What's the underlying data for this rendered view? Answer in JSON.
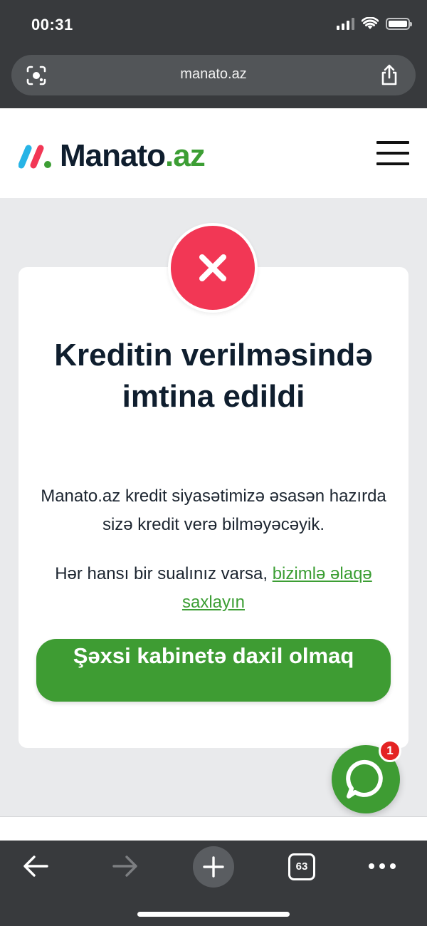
{
  "status_bar": {
    "time": "00:31"
  },
  "browser": {
    "url": "manato.az",
    "tab_count": "63"
  },
  "site": {
    "logo_name": "Manato",
    "logo_tld": ".az"
  },
  "card": {
    "title": "Kreditin verilməsində imtina edildi",
    "message": "Manato.az kredit siyasətimizə əsasən hazırda sizə kredit verə bilməyəcəyik.",
    "contact_prefix": "Hər hansı bir sualınız varsa, ",
    "contact_link": "bizimlə əlaqə saxlayın",
    "button_label": "Şəxsi kabinetə daxil olmaq"
  },
  "chat": {
    "badge_count": "1"
  },
  "colors": {
    "brand_green": "#3e9c33",
    "error_red": "#f23755",
    "dark_text": "#0f1e2e",
    "browser_chrome": "#383a3d"
  },
  "icons": [
    "screenshot-lens-icon",
    "share-icon",
    "hamburger-menu-icon",
    "close-x-icon",
    "chat-bubble-icon",
    "back-arrow-icon",
    "forward-arrow-icon",
    "plus-icon",
    "more-dots-icon"
  ]
}
